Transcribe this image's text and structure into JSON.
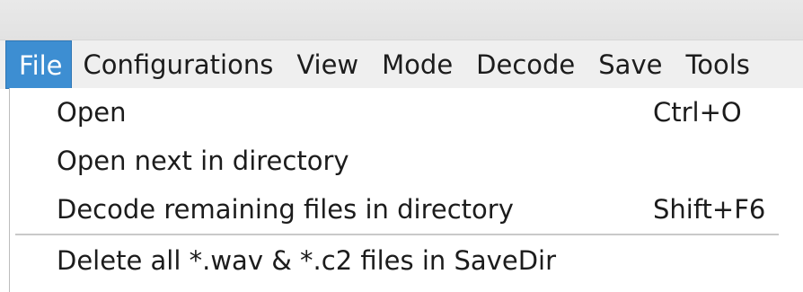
{
  "menubar": {
    "items": [
      {
        "label": "File",
        "active": true
      },
      {
        "label": "Configurations"
      },
      {
        "label": "View"
      },
      {
        "label": "Mode"
      },
      {
        "label": "Decode"
      },
      {
        "label": "Save"
      },
      {
        "label": "Tools"
      }
    ]
  },
  "file_menu": {
    "items": [
      {
        "label": "Open",
        "shortcut": "Ctrl+O"
      },
      {
        "label": "Open next in directory",
        "shortcut": ""
      },
      {
        "label": "Decode remaining files in directory",
        "shortcut": "Shift+F6"
      },
      {
        "label": "Delete all *.wav & *.c2 files in SaveDir",
        "shortcut": ""
      }
    ]
  },
  "colors": {
    "menu_highlight": "#3d8ed2",
    "menubar_bg": "#efefef",
    "dropdown_bg": "#ffffff"
  }
}
